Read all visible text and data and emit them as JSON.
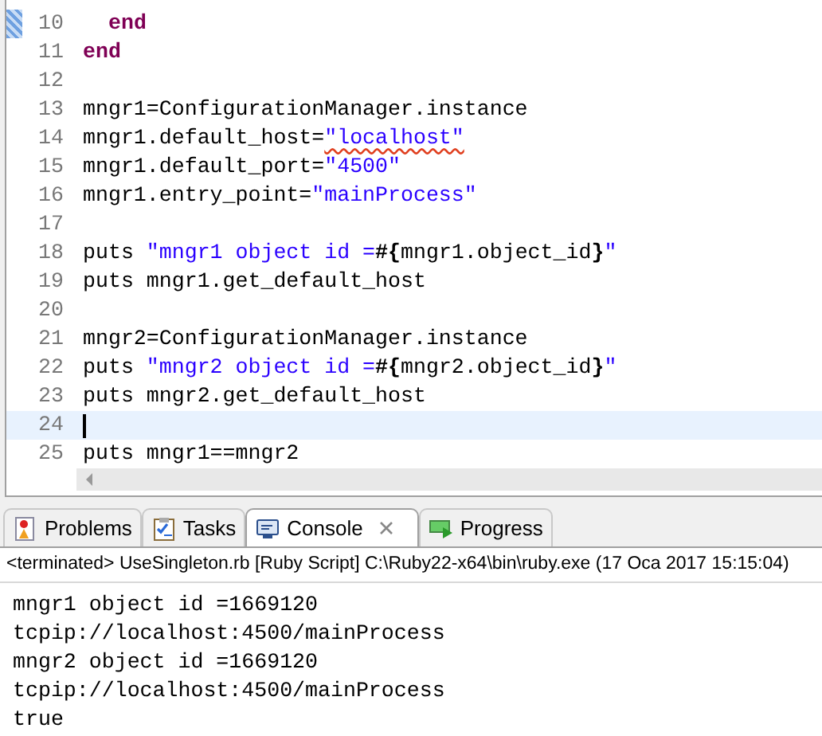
{
  "editor": {
    "lines": [
      {
        "number": "10",
        "current": false,
        "marker": true,
        "indented": true,
        "tokens": [
          {
            "kind": "keyword",
            "text": "end"
          }
        ]
      },
      {
        "number": "11",
        "current": false,
        "marker": false,
        "indented": false,
        "tokens": [
          {
            "kind": "keyword",
            "text": "end"
          }
        ]
      },
      {
        "number": "12",
        "current": false,
        "marker": false
      },
      {
        "number": "13",
        "current": false,
        "marker": false,
        "indented": false,
        "tokens": [
          {
            "kind": "plain",
            "text": "mngr1=ConfigurationManager.instance"
          }
        ]
      },
      {
        "number": "14",
        "current": false,
        "marker": false,
        "indented": false,
        "tokens": [
          {
            "kind": "plain",
            "text": "mngr1.default_host="
          },
          {
            "kind": "string",
            "text": "\"localhost\"",
            "misspelled": true
          }
        ]
      },
      {
        "number": "15",
        "current": false,
        "marker": false,
        "indented": false,
        "tokens": [
          {
            "kind": "plain",
            "text": "mngr1.default_port="
          },
          {
            "kind": "string",
            "text": "\"4500\"",
            "misspelled": false
          }
        ]
      },
      {
        "number": "16",
        "current": false,
        "marker": false,
        "indented": false,
        "tokens": [
          {
            "kind": "plain",
            "text": "mngr1.entry_point="
          },
          {
            "kind": "string",
            "text": "\"mainProcess\"",
            "misspelled": false
          }
        ]
      },
      {
        "number": "17",
        "current": false,
        "marker": false
      },
      {
        "number": "18",
        "current": false,
        "marker": false,
        "indented": false,
        "tokens": [
          {
            "kind": "plain",
            "text": "puts "
          },
          {
            "kind": "string",
            "text": "\"mngr1 object id =",
            "misspelled": false
          },
          {
            "kind": "interp",
            "text": "#{"
          },
          {
            "kind": "plain",
            "text": "mngr1.object_id"
          },
          {
            "kind": "interp",
            "text": "}"
          },
          {
            "kind": "string",
            "text": "\"",
            "misspelled": false
          }
        ]
      },
      {
        "number": "19",
        "current": false,
        "marker": false,
        "indented": false,
        "tokens": [
          {
            "kind": "plain",
            "text": "puts mngr1.get_default_host"
          }
        ]
      },
      {
        "number": "20",
        "current": false,
        "marker": false
      },
      {
        "number": "21",
        "current": false,
        "marker": false,
        "indented": false,
        "tokens": [
          {
            "kind": "plain",
            "text": "mngr2=ConfigurationManager.instance"
          }
        ]
      },
      {
        "number": "22",
        "current": false,
        "marker": false,
        "indented": false,
        "tokens": [
          {
            "kind": "plain",
            "text": "puts "
          },
          {
            "kind": "string",
            "text": "\"mngr2 object id =",
            "misspelled": false
          },
          {
            "kind": "interp",
            "text": "#{"
          },
          {
            "kind": "plain",
            "text": "mngr2.object_id"
          },
          {
            "kind": "interp",
            "text": "}"
          },
          {
            "kind": "string",
            "text": "\"",
            "misspelled": false
          }
        ]
      },
      {
        "number": "23",
        "current": false,
        "marker": false,
        "indented": false,
        "tokens": [
          {
            "kind": "plain",
            "text": "puts mngr2.get_default_host"
          }
        ]
      },
      {
        "number": "24",
        "current": true,
        "marker": false
      },
      {
        "number": "25",
        "current": false,
        "marker": false,
        "indented": false,
        "tokens": [
          {
            "kind": "plain",
            "text": "puts mngr1==mngr2"
          }
        ]
      }
    ]
  },
  "panel": {
    "tabs": [
      {
        "label": "Problems",
        "kind": "problems",
        "selected": false,
        "closable": false
      },
      {
        "label": "Tasks",
        "kind": "tasks",
        "selected": false,
        "closable": false
      },
      {
        "label": "Console",
        "kind": "console",
        "selected": true,
        "closable": true
      },
      {
        "label": "Progress",
        "kind": "progress",
        "selected": false,
        "closable": false
      }
    ],
    "status": "<terminated> UseSingleton.rb [Ruby Script] C:\\Ruby22-x64\\bin\\ruby.exe (17 Oca 2017 15:15:04)",
    "output": [
      "mngr1 object id =1669120",
      "tcpip://localhost:4500/mainProcess",
      "mngr2 object id =1669120",
      "tcpip://localhost:4500/mainProcess",
      "true"
    ]
  }
}
